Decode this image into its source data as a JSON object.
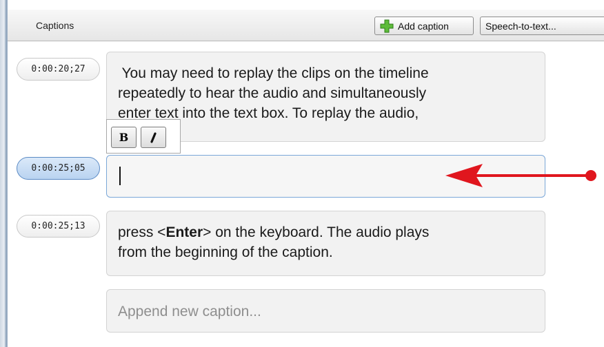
{
  "header": {
    "title": "Captions",
    "add_caption_label": "Add caption",
    "speech_to_text_label": "Speech-to-text..."
  },
  "captions": [
    {
      "timestamp": "0:00:20;27",
      "lines": [
        " You may need to replay the clips on the timeline",
        "repeatedly to hear the audio and simultaneously",
        "enter text into the text box. To replay the audio,"
      ]
    },
    {
      "timestamp": "0:00:25;05",
      "text": ""
    },
    {
      "timestamp": "0:00:25;13",
      "line1_before": "press <",
      "line1_bold": "Enter",
      "line1_after": "> on the keyboard. The audio plays",
      "line2": "from the beginning of the caption."
    }
  ],
  "append_placeholder": "Append new caption...",
  "format_toolbar": {
    "bold_label": "B"
  },
  "colors": {
    "active_timestamp": "#b9d3f0",
    "arrow": "#e0161e",
    "plus_icon": "#4caf2a"
  }
}
